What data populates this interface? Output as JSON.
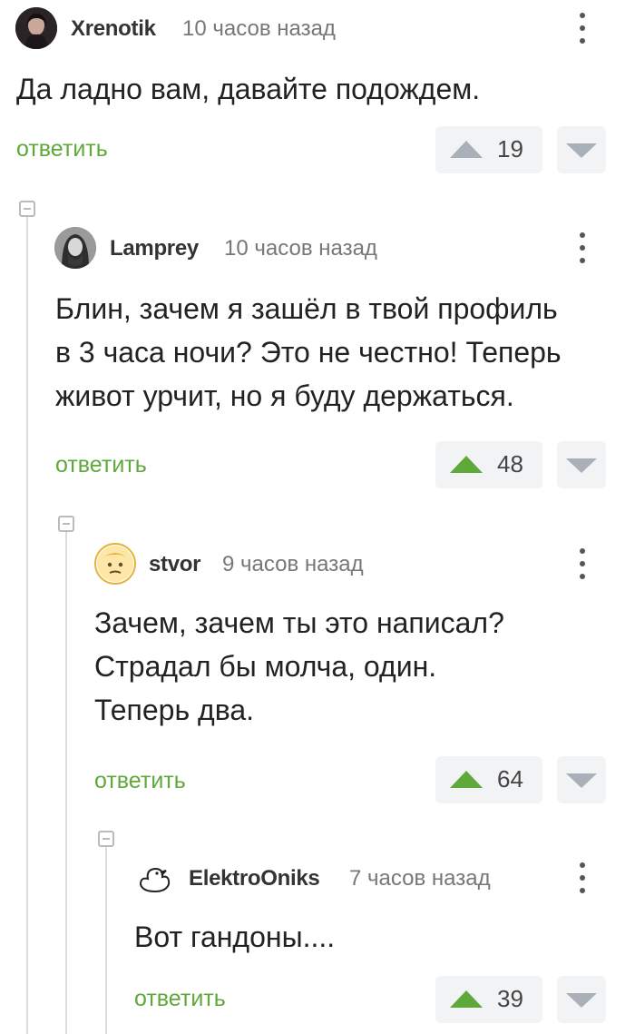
{
  "comments": [
    {
      "author": "Xrenotik",
      "time": "10 часов назад",
      "text": "Да ладно вам, давайте подождем.",
      "reply_label": "ответить",
      "rating": "19",
      "upvoted": false,
      "avatar_icon": "user-avatar-photo"
    },
    {
      "author": "Lamprey",
      "time": "10 часов назад",
      "text": "Блин, зачем я зашёл в твой профиль\nв 3 часа ночи? Это не честно! Теперь\nживот урчит, но я буду держаться.",
      "reply_label": "ответить",
      "rating": "48",
      "upvoted": true,
      "avatar_icon": "user-avatar-photo"
    },
    {
      "author": "stvor",
      "time": "9 часов назад",
      "text": "Зачем, зачем ты это написал?\nСтрадал бы молча, один.\nТеперь два.",
      "reply_label": "ответить",
      "rating": "64",
      "upvoted": true,
      "avatar_icon": "cartoon-face-avatar"
    },
    {
      "author": "ElektroOniks",
      "time": "7 часов назад",
      "text": "Вот гандоны....",
      "reply_label": "ответить",
      "rating": "39",
      "upvoted": true,
      "avatar_icon": "duck-outline-avatar"
    }
  ],
  "colors": {
    "accent_green": "#5fa83a",
    "vote_bg": "#f2f3f5",
    "upvote_inactive": "#aab0b8",
    "thread_line": "#dddddd"
  }
}
